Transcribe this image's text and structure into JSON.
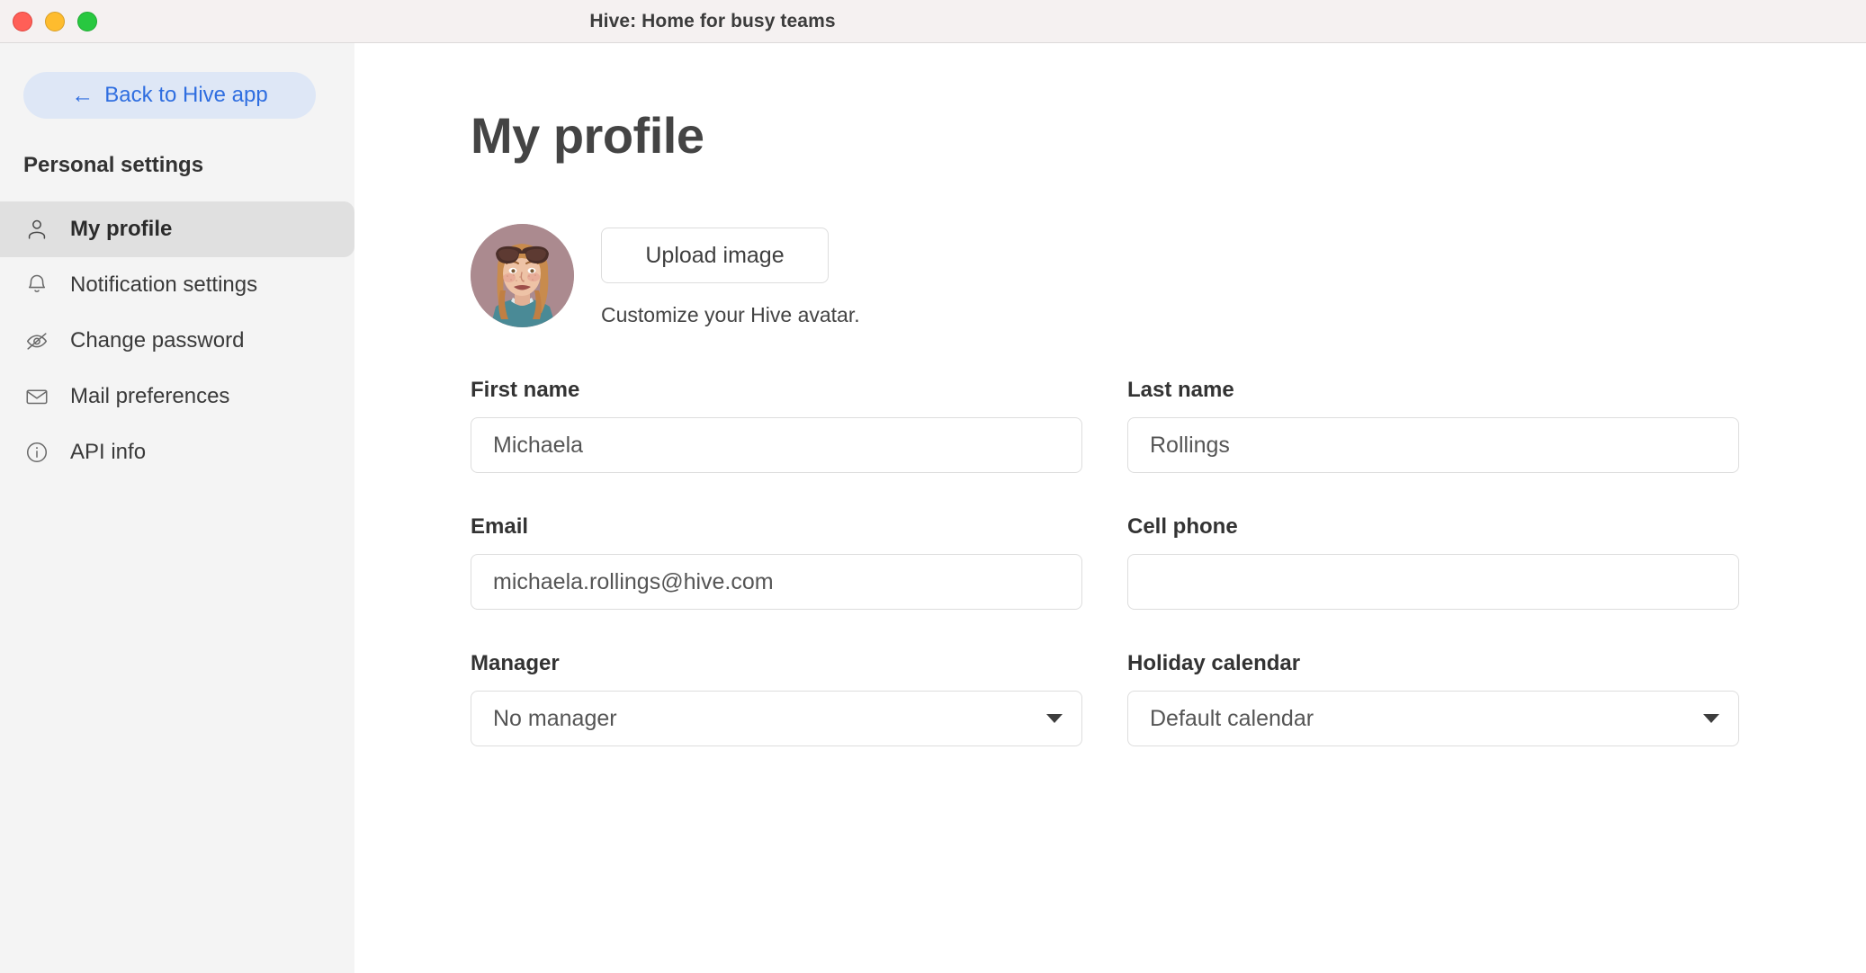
{
  "window": {
    "title": "Hive: Home for busy teams",
    "controls": [
      "close",
      "minimize",
      "maximize"
    ]
  },
  "sidebar": {
    "back_button": {
      "label": "Back to Hive app",
      "arrow": "←",
      "icon": "arrow-left-icon",
      "bg_color": "#dee7f6",
      "text_color": "#2f6ee0"
    },
    "section_title": "Personal settings",
    "items": [
      {
        "label": "My profile",
        "icon": "user-icon",
        "active": true
      },
      {
        "label": "Notification settings",
        "icon": "bell-icon",
        "active": false
      },
      {
        "label": "Change password",
        "icon": "eye-off-icon",
        "active": false
      },
      {
        "label": "Mail preferences",
        "icon": "envelope-icon",
        "active": false
      },
      {
        "label": "API info",
        "icon": "info-icon",
        "active": false
      }
    ],
    "active_bg_color": "#e0e0e0",
    "bg_color": "#f4f4f4"
  },
  "main": {
    "page_title": "My profile",
    "avatar": {
      "alt": "User avatar illustration",
      "bg_color": "#ab8a8f",
      "hair_color": "#c88b4d",
      "shirt_color": "#4a8a96",
      "glasses_color": "#4a2e28",
      "skin_color": "#e8bfa4"
    },
    "upload": {
      "button_label": "Upload image",
      "hint": "Customize your Hive avatar."
    },
    "fields": [
      {
        "label": "First name",
        "type": "text",
        "value": "Michaela",
        "placeholder": ""
      },
      {
        "label": "Last name",
        "type": "text",
        "value": "Rollings",
        "placeholder": ""
      },
      {
        "label": "Email",
        "type": "text",
        "value": "michaela.rollings@hive.com",
        "placeholder": ""
      },
      {
        "label": "Cell phone",
        "type": "text",
        "value": "",
        "placeholder": ""
      },
      {
        "label": "Manager",
        "type": "select",
        "value": "No manager",
        "options": [
          "No manager"
        ]
      },
      {
        "label": "Holiday calendar",
        "type": "select",
        "value": "Default calendar",
        "options": [
          "Default calendar"
        ]
      }
    ]
  }
}
